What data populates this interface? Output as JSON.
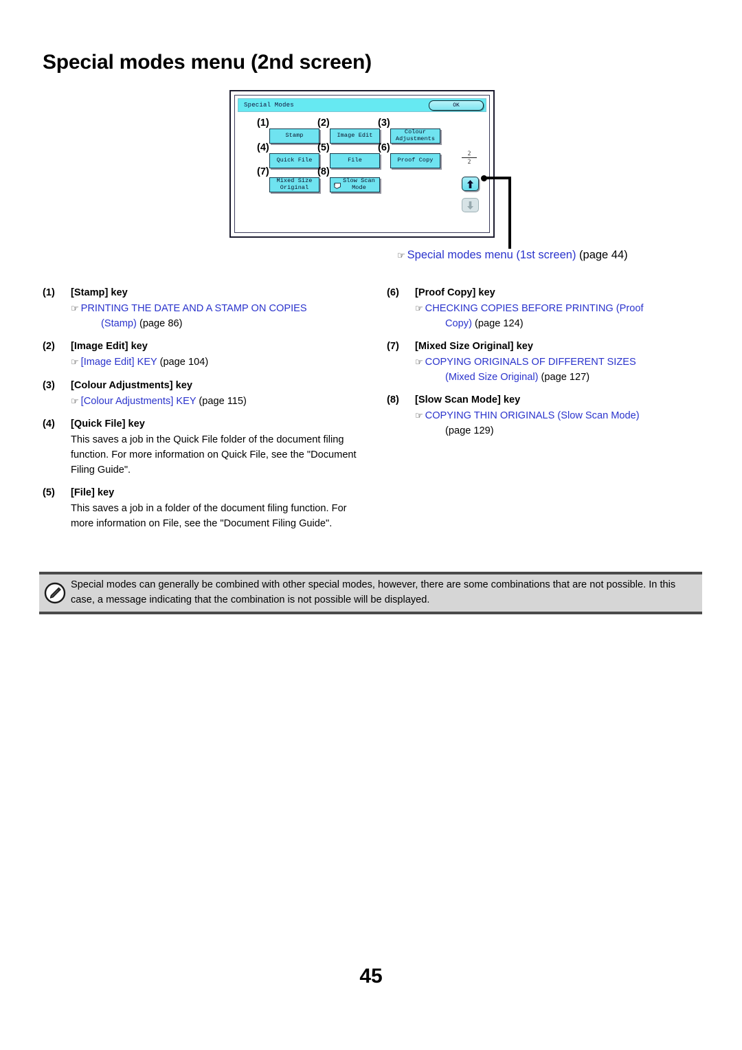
{
  "page": {
    "title": "Special modes menu (2nd screen)",
    "number": "45"
  },
  "screen": {
    "title_bar_label": "Special Modes",
    "ok_label": "OK",
    "page_counter_current": "2",
    "page_counter_total": "2",
    "keys": [
      {
        "callout": "(1)",
        "label": "Stamp"
      },
      {
        "callout": "(2)",
        "label": "Image Edit"
      },
      {
        "callout": "(3)",
        "label": "Colour\nAdjustments"
      },
      {
        "callout": "(4)",
        "label": "Quick File"
      },
      {
        "callout": "(5)",
        "label": "File"
      },
      {
        "callout": "(6)",
        "label": "Proof Copy"
      },
      {
        "callout": "(7)",
        "label": "Mixed Size\nOriginal"
      },
      {
        "callout": "(8)",
        "label": "Slow Scan\nMode"
      }
    ],
    "scroll_up_icon": "arrow-up-icon",
    "scroll_down_icon": "arrow-down-icon"
  },
  "diagram_xref": {
    "hand": "☞",
    "link": "Special modes menu (1st screen)",
    "suffix": " (page 44)"
  },
  "left_column": [
    {
      "num": "(1)",
      "heading": "[Stamp] key",
      "type": "xref",
      "hand": "☞",
      "link_main": "PRINTING THE DATE AND A STAMP ON COPIES",
      "link_cont": "(Stamp)",
      "page": " (page 86)"
    },
    {
      "num": "(2)",
      "heading": "[Image Edit] key",
      "type": "xref",
      "hand": "☞",
      "link_main": "[Image Edit] KEY",
      "link_cont": "",
      "page": " (page 104)"
    },
    {
      "num": "(3)",
      "heading": "[Colour Adjustments] key",
      "type": "xref",
      "hand": "☞",
      "link_main": "[Colour Adjustments] KEY",
      "link_cont": "",
      "page": " (page 115)"
    },
    {
      "num": "(4)",
      "heading": "[Quick File] key",
      "type": "text",
      "body": "This saves a job in the Quick File folder of the document filing function. For more information on Quick File, see the \"Document Filing Guide\"."
    },
    {
      "num": "(5)",
      "heading": "[File] key",
      "type": "text",
      "body": "This saves a job in a folder of the document filing function. For more information on File, see the \"Document Filing Guide\"."
    }
  ],
  "right_column": [
    {
      "num": "(6)",
      "heading": "[Proof Copy] key",
      "type": "xref",
      "hand": "☞",
      "link_main": "CHECKING COPIES BEFORE PRINTING (Proof",
      "link_cont": "Copy)",
      "page": " (page 124)"
    },
    {
      "num": "(7)",
      "heading": "[Mixed Size Original] key",
      "type": "xref",
      "hand": "☞",
      "link_main": "COPYING ORIGINALS OF DIFFERENT SIZES",
      "link_cont": "(Mixed Size Original)",
      "page": " (page 127)"
    },
    {
      "num": "(8)",
      "heading": "[Slow Scan Mode] key",
      "type": "xref",
      "hand": "☞",
      "link_main": "COPYING THIN ORIGINALS (Slow Scan Mode)",
      "link_cont": "",
      "page": "(page 129)"
    }
  ],
  "note": {
    "icon": "pencil-note-icon",
    "text": "Special modes can generally be combined with other special modes, however, there are some combinations that are not possible. In this case, a message indicating that the combination is not possible will be displayed."
  },
  "colors": {
    "link": "#2a33cc",
    "screen_cyan": "#66e9f2",
    "key_cyan": "#6fe3f0",
    "note_bg": "#d6d6d6"
  }
}
